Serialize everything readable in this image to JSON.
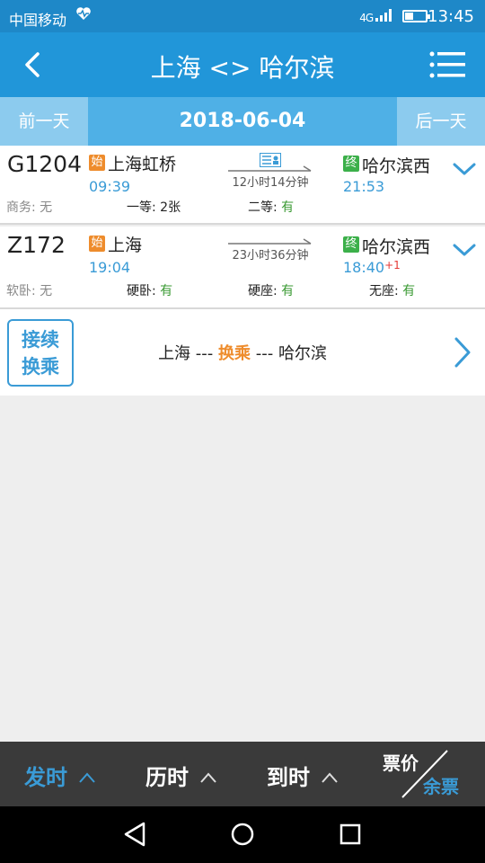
{
  "status_bar": {
    "carrier": "中国移动",
    "network": "4G",
    "time": "13:45"
  },
  "header": {
    "title": "上海 <> 哈尔滨"
  },
  "date_bar": {
    "prev_label": "前一天",
    "date": "2018-06-04",
    "next_label": "后一天"
  },
  "trains": [
    {
      "code": "G1204",
      "start_badge": "始",
      "from_station": "上海虹桥",
      "depart_time": "09:39",
      "duration": "12小时14分钟",
      "end_badge": "终",
      "to_station": "哈尔滨西",
      "arrive_time": "21:53",
      "day_offset": "",
      "seats": [
        {
          "label": "商务: ",
          "value": "无"
        },
        {
          "label": "一等: ",
          "value": "2张"
        },
        {
          "label": "二等: ",
          "value": "有"
        }
      ]
    },
    {
      "code": "Z172",
      "start_badge": "始",
      "from_station": "上海",
      "depart_time": "19:04",
      "duration": "23小时36分钟",
      "end_badge": "终",
      "to_station": "哈尔滨西",
      "arrive_time": "18:40",
      "day_offset": "+1",
      "seats": [
        {
          "label": "软卧: ",
          "value": "无"
        },
        {
          "label": "硬卧: ",
          "value": "有"
        },
        {
          "label": "硬座: ",
          "value": "有"
        },
        {
          "label": "无座: ",
          "value": "有"
        }
      ]
    }
  ],
  "transfer": {
    "box_line1": "接续",
    "box_line2": "换乘",
    "from": "上海",
    "sep1": " --- ",
    "middle": "换乘",
    "sep2": " --- ",
    "to": "哈尔滨"
  },
  "sort_bar": {
    "depart": "发时",
    "duration": "历时",
    "arrive": "到时",
    "price": "票价",
    "remain": "余票"
  },
  "colors": {
    "primary": "#2196d9",
    "accent_orange": "#ee8c2c",
    "available_green": "#3a9a33",
    "red": "#e53935"
  }
}
